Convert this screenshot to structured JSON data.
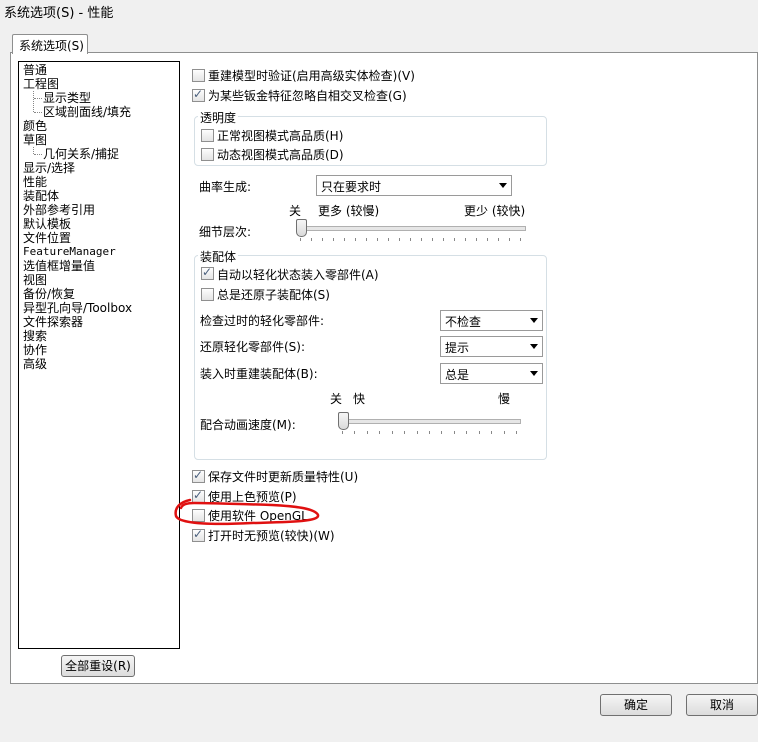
{
  "window": {
    "title": "系统选项(S) - 性能"
  },
  "tabs": [
    {
      "label": "系统选项(S)"
    }
  ],
  "tree": {
    "items": [
      "普通",
      "工程图",
      "显示类型",
      "区域剖面线/填充",
      "颜色",
      "草图",
      "几何关系/捕捉",
      "显示/选择",
      "性能",
      "装配体",
      "外部参考引用",
      "默认模板",
      "文件位置",
      "FeatureManager",
      "选值框增量值",
      "视图",
      "备份/恢复",
      "异型孔向导/Toolbox",
      "文件探索器",
      "搜索",
      "协作",
      "高级"
    ]
  },
  "reset_button": "全部重设(R)",
  "options": {
    "rebuild_verify": {
      "label": "重建模型时验证(启用高级实体检查)(V)",
      "checked": false
    },
    "ignore_self_intersect": {
      "label": "为某些钣金特征忽略自相交叉检查(G)",
      "checked": true
    }
  },
  "transparency": {
    "title": "透明度",
    "normal_view": {
      "label": "正常视图模式高品质(H)",
      "checked": false
    },
    "dynamic_view": {
      "label": "动态视图模式高品质(D)",
      "checked": false
    }
  },
  "curvature": {
    "label": "曲率生成:",
    "value": "只在要求时"
  },
  "detail": {
    "label": "细节层次:",
    "left": "关",
    "mid": "更多 (较慢)",
    "right": "更少 (较快)",
    "level": 0
  },
  "assembly": {
    "title": "装配体",
    "auto_lightweight": {
      "label": "自动以轻化状态装入零部件(A)",
      "checked": true
    },
    "always_resolve": {
      "label": "总是还原子装配体(S)",
      "checked": false
    },
    "check_outdated": {
      "label": "检查过时的轻化零部件:",
      "value": "不检查"
    },
    "resolve_lightweight": {
      "label": "还原轻化零部件(S):",
      "value": "提示"
    },
    "rebuild_on_load": {
      "label": "装入时重建装配体(B):",
      "value": "总是"
    },
    "anim_speed": {
      "label": "配合动画速度(M):",
      "left": "关",
      "mid": "快",
      "right": "慢",
      "level": 0
    }
  },
  "bottom_options": {
    "save_mass": {
      "label": "保存文件时更新质量特性(U)",
      "checked": true
    },
    "shaded_preview": {
      "label": "使用上色预览(P)",
      "checked": true
    },
    "software_opengl": {
      "label": "使用软件 OpenGL",
      "checked": false
    },
    "no_preview": {
      "label": "打开时无预览(较快)(W)",
      "checked": true
    }
  },
  "buttons": {
    "ok": "确定",
    "cancel": "取消"
  },
  "colors": {
    "annotation": "#e01010",
    "tab_border": "#8e8f8f"
  }
}
